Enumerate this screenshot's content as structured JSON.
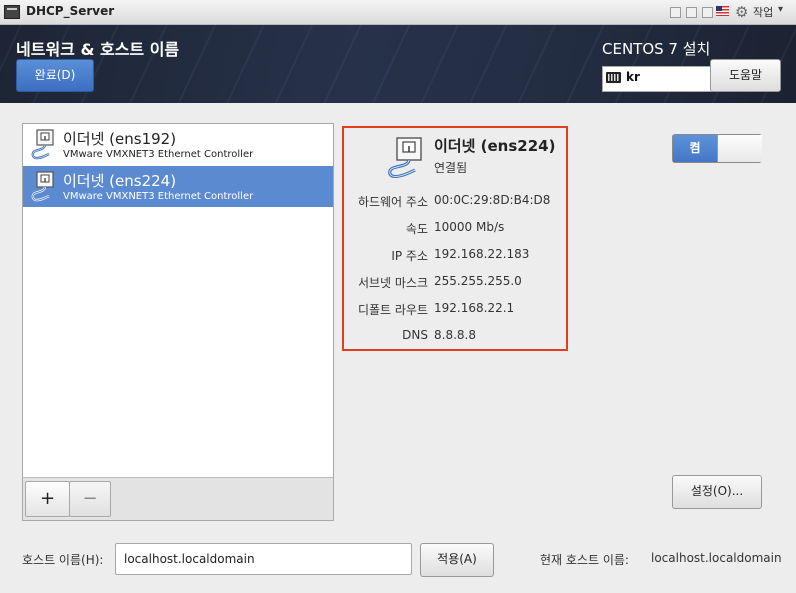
{
  "window": {
    "title": "DHCP_Server",
    "work_label": "작업"
  },
  "header": {
    "title": "네트워크 & 호스트 이름",
    "done_label": "완료(D)",
    "product": "CENTOS 7 설치",
    "lang_code": "kr",
    "help_label": "도움말"
  },
  "devices": [
    {
      "name": "이더넷 (ens192)",
      "desc": "VMware VMXNET3 Ethernet Controller",
      "selected": false
    },
    {
      "name": "이더넷 (ens224)",
      "desc": "VMware VMXNET3 Ethernet Controller",
      "selected": true
    }
  ],
  "list_toolbar": {
    "add": "+",
    "remove": "−"
  },
  "detail": {
    "title": "이더넷 (ens224)",
    "status": "연결됨",
    "rows": [
      {
        "label": "하드웨어 주소",
        "value": "00:0C:29:8D:B4:D8"
      },
      {
        "label": "속도",
        "value": "10000 Mb/s"
      },
      {
        "label": "IP 주소",
        "value": "192.168.22.183"
      },
      {
        "label": "서브넷 마스크",
        "value": "255.255.255.0"
      },
      {
        "label": "디폴트 라우트",
        "value": "192.168.22.1"
      },
      {
        "label": "DNS",
        "value": "8.8.8.8"
      }
    ]
  },
  "toggle": {
    "on_label": "켬",
    "state": true
  },
  "settings_label": "설정(O)...",
  "hostname": {
    "label": "호스트 이름(H):",
    "value": "localhost.localdomain",
    "apply_label": "적용(A)",
    "current_label": "현재 호스트 이름:",
    "current_value": "localhost.localdomain"
  },
  "colors": {
    "accent": "#5b8ad0",
    "highlight_border": "#e0401f",
    "header_bg": "#232d42"
  }
}
